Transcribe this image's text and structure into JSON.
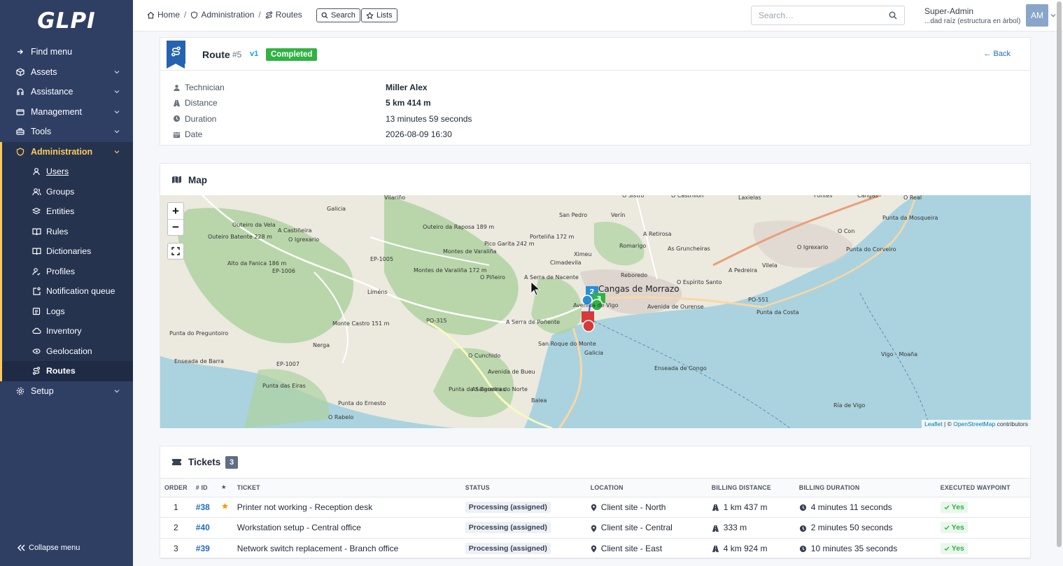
{
  "app": {
    "logo": "GLPI"
  },
  "sidebar": {
    "items": [
      {
        "label": "Find menu",
        "icon": "search-icon",
        "chevron": false
      },
      {
        "label": "Assets",
        "icon": "package-icon",
        "chevron": true
      },
      {
        "label": "Assistance",
        "icon": "headset-icon",
        "chevron": true
      },
      {
        "label": "Management",
        "icon": "wallet-icon",
        "chevron": true
      },
      {
        "label": "Tools",
        "icon": "briefcase-icon",
        "chevron": true
      },
      {
        "label": "Administration",
        "icon": "shield-icon",
        "chevron": true
      }
    ],
    "admin_sub": [
      {
        "label": "Users",
        "icon": "user-icon"
      },
      {
        "label": "Groups",
        "icon": "users-icon"
      },
      {
        "label": "Entities",
        "icon": "stack-icon"
      },
      {
        "label": "Rules",
        "icon": "book-icon"
      },
      {
        "label": "Dictionaries",
        "icon": "book-icon"
      },
      {
        "label": "Profiles",
        "icon": "user-check-icon"
      },
      {
        "label": "Notification queue",
        "icon": "notification-icon"
      },
      {
        "label": "Logs",
        "icon": "log-icon"
      },
      {
        "label": "Inventory",
        "icon": "cloud-icon"
      },
      {
        "label": "Geolocation",
        "icon": "globe-icon"
      },
      {
        "label": "Routes",
        "icon": "route-icon"
      }
    ],
    "setup": {
      "label": "Setup",
      "icon": "gear-icon"
    },
    "collapse_label": "Collapse menu"
  },
  "header": {
    "breadcrumbs": [
      "Home",
      "Administration",
      "Routes"
    ],
    "search_btn": "Search",
    "lists_btn": "Lists",
    "search_placeholder": "Search…",
    "user_name": "Super-Admin",
    "user_entity": "...dad raíz (estructura en árbol)",
    "avatar_initials": "AM"
  },
  "route": {
    "title": "Route",
    "id": "#5",
    "version": "v1",
    "status": "Completed",
    "back": "Back",
    "fields": [
      {
        "label": "Technician",
        "value": "Miller Alex",
        "bold": true,
        "icon": "user-icon"
      },
      {
        "label": "Distance",
        "value": "5 km 414 m",
        "bold": true,
        "icon": "road-icon"
      },
      {
        "label": "Duration",
        "value": "13 minutes 59 seconds",
        "bold": false,
        "icon": "clock-icon"
      },
      {
        "label": "Date",
        "value": "2026-08-09 16:30",
        "bold": false,
        "icon": "calendar-icon"
      }
    ]
  },
  "map": {
    "title": "Map",
    "zoom_in": "+",
    "zoom_out": "−",
    "attribution_leaflet": "Leaflet",
    "attribution_sep": " | © ",
    "attribution_osm": "OpenStreetMap",
    "attribution_tail": " contributors",
    "labels": [
      "Vilariño",
      "Outeiro da Vela",
      "A Castiñeira",
      "O Igrexario",
      "Outeiro Batente 228 m",
      "Alto da Fanica 186 m",
      "EP-1006",
      "Outeiro da Raposa 189 m",
      "Montes de Varaliña",
      "Montes de Varaliña 172 m",
      "Pico Garita 242 m",
      "Porteliña 172 m",
      "San Pedro",
      "Verín",
      "A Retirosa",
      "Romarigo",
      "O Piñeiro",
      "A Serra de Nacente",
      "Cimadevila",
      "Ximeu",
      "Reboredo",
      "Cangas de Morrazo",
      "O Espírito Santo",
      "A Pedreira",
      "Vilela",
      "As Gruncheiras",
      "O Igrexario",
      "Punta do Corveiro",
      "Punta da Mosqueira",
      "O Con",
      "EP-1005",
      "Liméns",
      "PO-315",
      "A Serra de Poñente",
      "San Roque do Monte",
      "Monte Castro 151 m",
      "Punta do Preguntoiro",
      "Nerga",
      "EP-1007",
      "Enseada de Barra",
      "O Cunchido",
      "Punta das Eiras",
      "Punta do Ernesto",
      "O Rabelo",
      "Punta da Salgueira do Norte",
      "As Barreiras",
      "Balea",
      "Avenida de Bueu",
      "Avenida de Vigo",
      "Avenida de Ourense",
      "PO-551",
      "Punta da Costa",
      "Enseada de Congo",
      "Vigo - Moaña",
      "Laxielas",
      "O Castrillón",
      "O Sistro",
      "O Real",
      "Fontes",
      "Cangas",
      "Galicia",
      "Galicia",
      "Ría de Vigo"
    ],
    "markers": [
      "2",
      "3"
    ]
  },
  "tickets": {
    "title": "Tickets",
    "count": "3",
    "columns": [
      "Order",
      "# ID",
      "★",
      "Ticket",
      "Status",
      "Location",
      "Billing distance",
      "Billing duration",
      "Executed waypoint"
    ],
    "rows": [
      {
        "order": "1",
        "id": "#38",
        "starred": true,
        "ticket": "Printer not working - Reception desk",
        "status": "Processing (assigned)",
        "location": "Client site - North",
        "distance": "1 km 437 m",
        "duration": "4 minutes 11 seconds",
        "executed": "Yes"
      },
      {
        "order": "2",
        "id": "#40",
        "starred": false,
        "ticket": "Workstation setup - Central office",
        "status": "Processing (assigned)",
        "location": "Client site - Central",
        "distance": "333 m",
        "duration": "2 minutes 50 seconds",
        "executed": "Yes"
      },
      {
        "order": "3",
        "id": "#39",
        "starred": false,
        "ticket": "Network switch replacement - Branch office",
        "status": "Processing (assigned)",
        "location": "Client site - East",
        "distance": "4 km 924 m",
        "duration": "10 minutes 35 seconds",
        "executed": "Yes"
      }
    ]
  },
  "colors": {
    "sidebar_bg": "#2f3f64",
    "accent": "#fec95c",
    "status_green": "#2fb344",
    "link_blue": "#206bc4"
  }
}
